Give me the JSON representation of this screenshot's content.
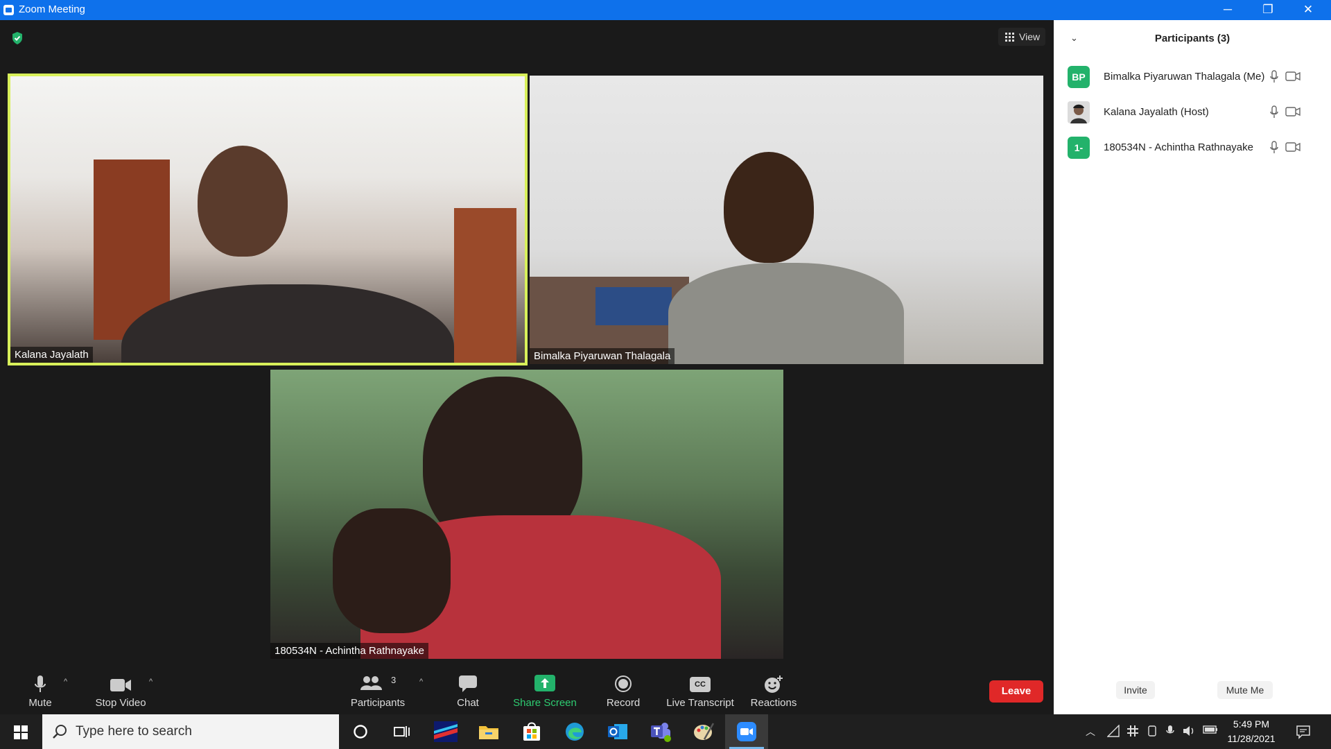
{
  "window": {
    "title": "Zoom Meeting",
    "controls": {
      "minimize": "─",
      "restore": "❐",
      "close": "✕"
    }
  },
  "stage": {
    "view_label": "View",
    "tiles": [
      {
        "name": "Kalana Jayalath",
        "active_speaker": true
      },
      {
        "name": "Bimalka Piyaruwan Thalagala",
        "active_speaker": false
      },
      {
        "name": "180534N - Achintha Rathnayake",
        "active_speaker": false
      }
    ]
  },
  "toolbar": {
    "mute": "Mute",
    "stop_video": "Stop Video",
    "participants": "Participants",
    "participants_count": "3",
    "chat": "Chat",
    "share_screen": "Share Screen",
    "record": "Record",
    "live_transcript": "Live Transcript",
    "cc_badge": "CC",
    "reactions": "Reactions",
    "leave": "Leave"
  },
  "panel": {
    "title": "Participants (3)",
    "participants": [
      {
        "initials": "BP",
        "name": "Bimalka Piyaruwan Thalagala (Me)"
      },
      {
        "initials": "",
        "name": "Kalana Jayalath (Host)"
      },
      {
        "initials": "1-",
        "name": "180534N - Achintha Rathnayake"
      }
    ],
    "invite": "Invite",
    "mute_me": "Mute Me"
  },
  "taskbar": {
    "search_placeholder": "Type here to search",
    "time": "5:49 PM",
    "date": "11/28/2021"
  },
  "colors": {
    "titlebar": "#0e71eb",
    "active_speaker_border": "#d8f05a",
    "avatar_green": "#23b26b",
    "leave_red": "#e02828",
    "share_green": "#2ecc71"
  }
}
